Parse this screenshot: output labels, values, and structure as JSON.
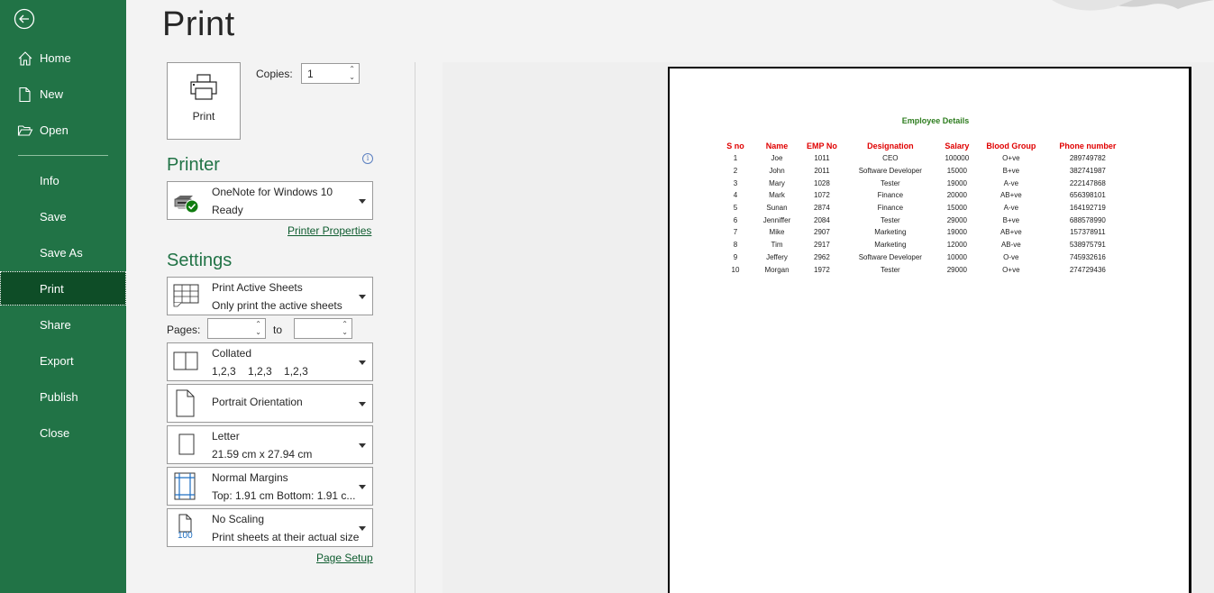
{
  "sidebar": {
    "back_icon": "back-arrow-icon",
    "items": [
      {
        "label": "Home",
        "icon": "home-icon"
      },
      {
        "label": "New",
        "icon": "new-document-icon"
      },
      {
        "label": "Open",
        "icon": "folder-open-icon"
      },
      {
        "label": "Info"
      },
      {
        "label": "Save"
      },
      {
        "label": "Save As"
      },
      {
        "label": "Print",
        "active": true
      },
      {
        "label": "Share"
      },
      {
        "label": "Export"
      },
      {
        "label": "Publish"
      },
      {
        "label": "Close"
      }
    ]
  },
  "main": {
    "title": "Print",
    "print_button": "Print",
    "copies_label": "Copies:",
    "copies_value": "1",
    "printer": {
      "heading": "Printer",
      "name": "OneNote for Windows 10",
      "status": "Ready",
      "properties_link": "Printer Properties"
    },
    "settings": {
      "heading": "Settings",
      "what_to_print": {
        "title": "Print Active Sheets",
        "subtitle": "Only print the active sheets"
      },
      "pages_label": "Pages:",
      "pages_from": "",
      "pages_to_label": "to",
      "pages_to": "",
      "collation": {
        "title": "Collated",
        "subtitle": "1,2,3    1,2,3    1,2,3"
      },
      "orientation": {
        "title": "Portrait Orientation"
      },
      "paper_size": {
        "title": "Letter",
        "subtitle": "21.59 cm x 27.94 cm"
      },
      "margins": {
        "title": "Normal Margins",
        "subtitle": "Top: 1.91 cm Bottom: 1.91 c..."
      },
      "scaling": {
        "title": "No Scaling",
        "subtitle": "Print sheets at their actual size",
        "icon_text": "100"
      },
      "page_setup_link": "Page Setup"
    }
  },
  "preview": {
    "title": "Employee Details",
    "headers": [
      "S no",
      "Name",
      "EMP No",
      "Designation",
      "Salary",
      "Blood Group",
      "Phone number"
    ],
    "rows": [
      [
        "1",
        "Joe",
        "1011",
        "CEO",
        "100000",
        "O+ve",
        "289749782"
      ],
      [
        "2",
        "John",
        "2011",
        "Software Developer",
        "15000",
        "B+ve",
        "382741987"
      ],
      [
        "3",
        "Mary",
        "1028",
        "Tester",
        "19000",
        "A-ve",
        "222147868"
      ],
      [
        "4",
        "Mark",
        "1072",
        "Finance",
        "20000",
        "AB+ve",
        "656398101"
      ],
      [
        "5",
        "Sunan",
        "2874",
        "Finance",
        "15000",
        "A-ve",
        "164192719"
      ],
      [
        "6",
        "Jenniffer",
        "2084",
        "Tester",
        "29000",
        "B+ve",
        "688578990"
      ],
      [
        "7",
        "Mike",
        "2907",
        "Marketing",
        "19000",
        "AB+ve",
        "157378911"
      ],
      [
        "8",
        "Tim",
        "2917",
        "Marketing",
        "12000",
        "AB-ve",
        "538975791"
      ],
      [
        "9",
        "Jeffery",
        "2962",
        "Software Developer",
        "10000",
        "O-ve",
        "745932616"
      ],
      [
        "10",
        "Morgan",
        "1972",
        "Tester",
        "29000",
        "O+ve",
        "274729436"
      ]
    ]
  },
  "colors": {
    "sidebar_bg": "#217346",
    "sidebar_active": "#0e4d27",
    "heading_green": "#217346",
    "table_header_red": "#e00000",
    "title_green": "#2e7d1f"
  }
}
